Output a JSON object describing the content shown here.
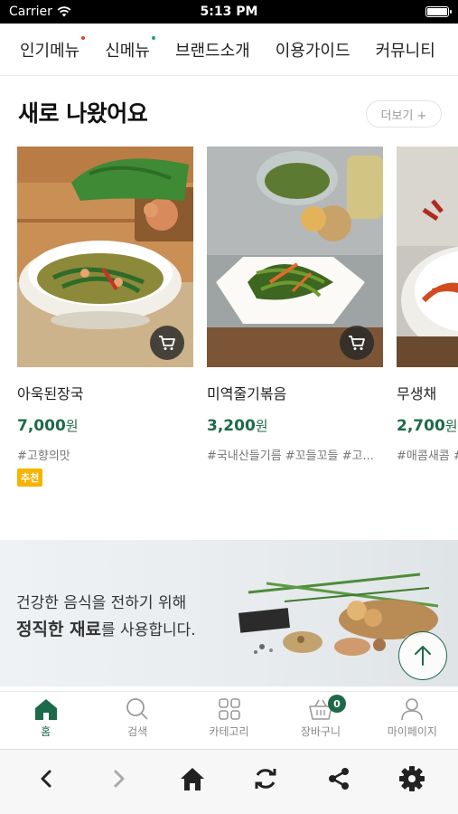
{
  "status_bar": {
    "carrier": "Carrier",
    "time": "5:13 PM"
  },
  "top_nav": {
    "items": [
      {
        "label": "인기메뉴",
        "dot_color": "#e0403a"
      },
      {
        "label": "신메뉴",
        "dot_color": "#2aa06a"
      },
      {
        "label": "브랜드소개"
      },
      {
        "label": "이용가이드"
      },
      {
        "label": "커뮤니티"
      }
    ]
  },
  "section": {
    "title": "새로 나왔어요",
    "more_label": "더보기 +"
  },
  "products": [
    {
      "name": "아욱된장국",
      "price": "7,000",
      "currency": "원",
      "tags": "#고향의맛",
      "badge": "추천",
      "image": "soybean-soup-photo"
    },
    {
      "name": "미역줄기볶음",
      "price": "3,200",
      "currency": "원",
      "tags": "#국내산들기름 #꼬들꼬들 #고...",
      "image": "seaweed-stir-fry-photo"
    },
    {
      "name": "무생채",
      "price": "2,700",
      "currency": "원",
      "tags": "#매콤새콤 #",
      "image": "radish-salad-photo"
    }
  ],
  "banner": {
    "line1": "건강한 음식을 전하기 위해",
    "line2_bold": "정직한 재료",
    "line2_rest": "를 사용합니다."
  },
  "tab_bar": {
    "tabs": [
      {
        "label": "홈",
        "icon": "home-icon",
        "active": true
      },
      {
        "label": "검색",
        "icon": "search-icon"
      },
      {
        "label": "카테고리",
        "icon": "grid-icon"
      },
      {
        "label": "장바구니",
        "icon": "basket-icon",
        "count": "0"
      },
      {
        "label": "마이페이지",
        "icon": "person-icon"
      }
    ]
  },
  "browser_bar": {
    "icons": [
      "back-icon",
      "forward-icon",
      "home-icon",
      "refresh-icon",
      "share-icon",
      "settings-icon"
    ]
  },
  "colors": {
    "accent": "#1d6a4a",
    "badge": "#f6b400"
  }
}
